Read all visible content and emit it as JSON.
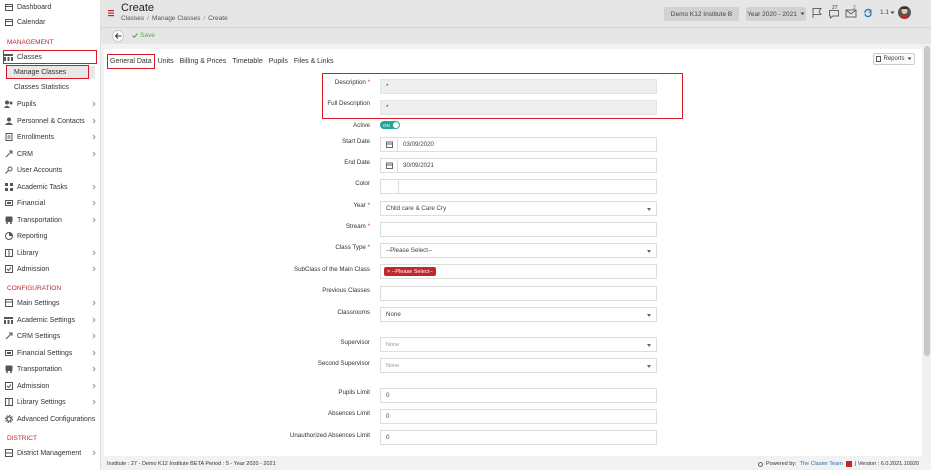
{
  "sidebar": {
    "top_items": [
      {
        "label": "Dashboard",
        "icon": "dashboard-icon"
      },
      {
        "label": "Calendar",
        "icon": "calendar-icon"
      }
    ],
    "management_header": "MANAGEMENT",
    "classes_label": "Classes",
    "classes_sub": [
      "Manage Classes",
      "Classes Statistics"
    ],
    "management_items": [
      {
        "label": "Pupils",
        "icon": "pupils-icon"
      },
      {
        "label": "Personnel & Contacts",
        "icon": "personnel-icon"
      },
      {
        "label": "Enrollments",
        "icon": "enrollments-icon"
      },
      {
        "label": "CRM",
        "icon": "crm-icon"
      },
      {
        "label": "User Accounts",
        "icon": "key-icon"
      },
      {
        "label": "Academic Tasks",
        "icon": "tasks-icon"
      },
      {
        "label": "Financial",
        "icon": "financial-icon"
      },
      {
        "label": "Transportation",
        "icon": "bus-icon"
      },
      {
        "label": "Reporting",
        "icon": "reporting-icon"
      },
      {
        "label": "Library",
        "icon": "library-icon"
      },
      {
        "label": "Admission",
        "icon": "admission-icon"
      }
    ],
    "configuration_header": "CONFIGURATION",
    "configuration_items": [
      {
        "label": "Main Settings",
        "icon": "settings-icon"
      },
      {
        "label": "Academic Settings",
        "icon": "academic-icon"
      },
      {
        "label": "CRM Settings",
        "icon": "crm-icon"
      },
      {
        "label": "Financial Settings",
        "icon": "financial-icon"
      },
      {
        "label": "Transportation",
        "icon": "bus-icon"
      },
      {
        "label": "Admission",
        "icon": "admission-icon"
      },
      {
        "label": "Library Settings",
        "icon": "library-icon"
      },
      {
        "label": "Advanced Configurations",
        "icon": "gear-icon"
      }
    ],
    "district_header": "DISTRICT",
    "district_items": [
      {
        "label": "District Management",
        "icon": "district-icon"
      }
    ]
  },
  "header": {
    "title": "Create",
    "breadcrumb": [
      "Classes",
      "Manage Classes",
      "Create"
    ],
    "institute": "Demo K12 Institute B",
    "year": "Year 2020 - 2021",
    "notif_count_1": "27",
    "notif_count_2": "2",
    "user_short": "1.1"
  },
  "actions": {
    "save_label": "Save"
  },
  "tabs": [
    "General Data",
    "Units",
    "Billing & Prices",
    "Timetable",
    "Pupils",
    "Files & Links"
  ],
  "reports_label": "Reports",
  "form": {
    "description_label": "Description",
    "full_description_label": "Full Description",
    "description_value": "*",
    "full_description_value": "*",
    "active_label": "Active",
    "active_toggle": "ON",
    "start_date_label": "Start Date",
    "start_date": "03/09/2020",
    "end_date_label": "End Date",
    "end_date": "30/09/2021",
    "color_label": "Color",
    "year_label": "Year",
    "year_value": "Child care & Care Cry",
    "stream_label": "Stream",
    "class_type_label": "Class Type",
    "class_type_value": "--Please Select--",
    "subclass_label": "SubClass of the Main Class",
    "subclass_chip": "× --Please Select--",
    "previous_classes_label": "Previous Classes",
    "classrooms_label": "Classrooms",
    "classrooms_value": "None",
    "supervisor_label": "Supervisor",
    "supervisor_value": "None",
    "second_supervisor_label": "Second Supervisor",
    "second_supervisor_value": "None",
    "pupils_limit_label": "Pupils Limit",
    "pupils_limit": "0",
    "absences_limit_label": "Absences Limit",
    "absences_limit": "0",
    "unauthorized_label": "Unauthorized Absences Limit",
    "unauthorized_limit": "0"
  },
  "footer": {
    "left": "Institute : 27 - Demo K12 Institute BETA Period : 5 - Year 2020 - 2021",
    "powered": "Powered by:",
    "team": "The Claster Team",
    "version": "| Version : 6.0.2021.10920"
  },
  "colors": {
    "accent_red": "#c0272d",
    "save_green": "#4caf50",
    "toggle_teal": "#26a69a",
    "highlight_box": "#d91a2a"
  }
}
